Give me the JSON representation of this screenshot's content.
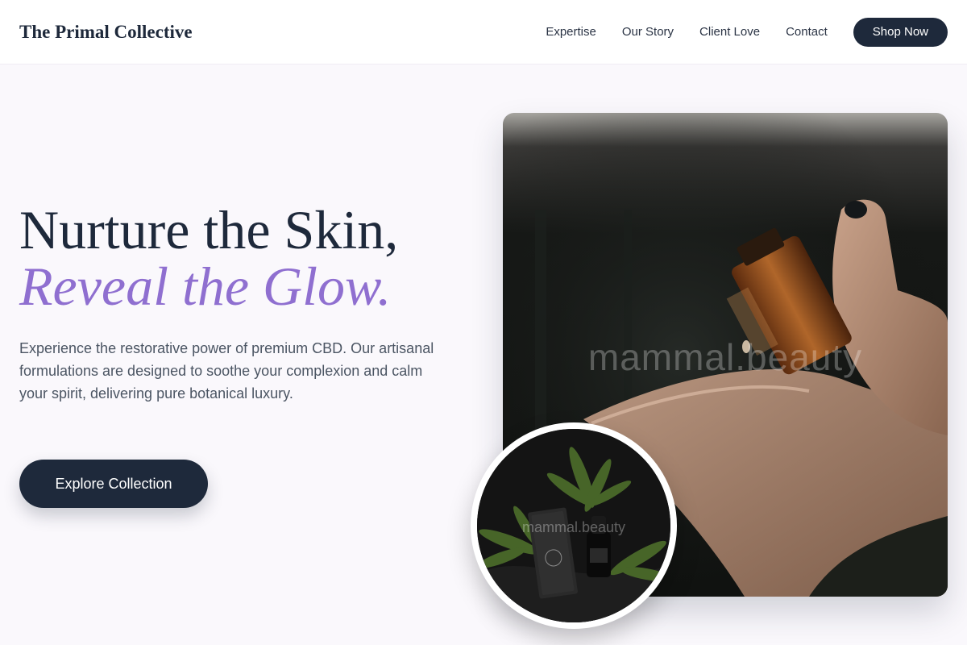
{
  "header": {
    "brand": "The Primal Collective",
    "nav": [
      "Expertise",
      "Our Story",
      "Client Love",
      "Contact"
    ],
    "cta": "Shop Now"
  },
  "hero": {
    "title_line1": "Nurture the Skin,",
    "title_line2": "Reveal the Glow.",
    "description": "Experience the restorative power of premium CBD. Our artisanal formulations are designed to soothe your complexion and calm your spirit, delivering pure botanical luxury.",
    "cta": "Explore Collection"
  },
  "images": {
    "main_watermark": "mammal.beauty",
    "circle_watermark": "mammal.beauty"
  },
  "colors": {
    "primary": "#1e293b",
    "accent": "#8f6fd0",
    "background": "#faf8fc"
  }
}
